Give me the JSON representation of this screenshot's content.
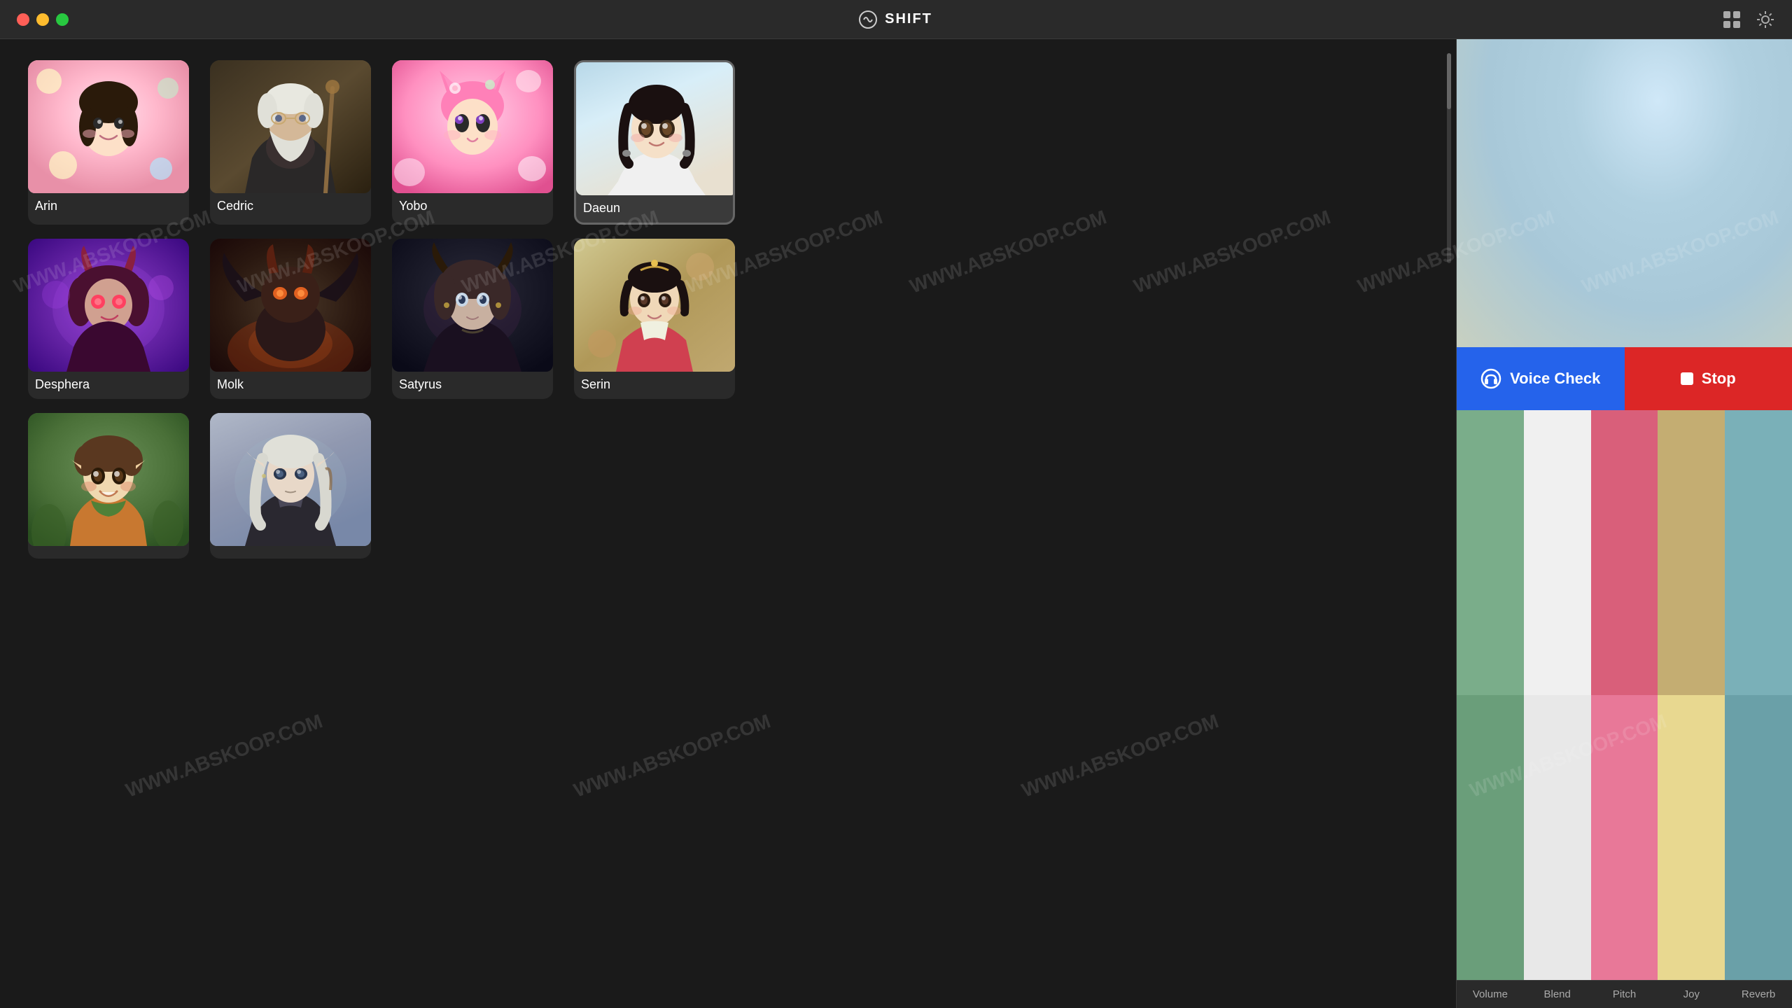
{
  "app": {
    "title": "SHIFT",
    "logo_symbol": "⟳"
  },
  "titlebar": {
    "traffic_lights": [
      "red",
      "yellow",
      "green"
    ],
    "right_icons": [
      "grid-icon",
      "settings-icon"
    ]
  },
  "characters": [
    {
      "id": "arin",
      "name": "Arin",
      "style": "arin",
      "selected": false
    },
    {
      "id": "cedric",
      "name": "Cedric",
      "style": "cedric",
      "selected": false
    },
    {
      "id": "yobo",
      "name": "Yobo",
      "style": "yobo",
      "selected": false
    },
    {
      "id": "daeun",
      "name": "Daeun",
      "style": "daeun",
      "selected": true
    },
    {
      "id": "desphera",
      "name": "Desphera",
      "style": "desphera",
      "selected": false
    },
    {
      "id": "molk",
      "name": "Molk",
      "style": "molk",
      "selected": false
    },
    {
      "id": "satyrus",
      "name": "Satyrus",
      "style": "satyrus",
      "selected": false
    },
    {
      "id": "serin",
      "name": "Serin",
      "style": "serin",
      "selected": false
    },
    {
      "id": "elf1",
      "name": "",
      "style": "elf1",
      "selected": false
    },
    {
      "id": "elf2",
      "name": "",
      "style": "elf2",
      "selected": false
    }
  ],
  "right_panel": {
    "selected_character": "Daeun",
    "voice_check_label": "Voice Check",
    "stop_label": "Stop",
    "color_swatches": [
      {
        "row": 1,
        "cells": [
          {
            "color": "#7aad8a"
          },
          {
            "color": "#f0f0f0"
          },
          {
            "color": "#d95f7a"
          },
          {
            "color": "#c4ad72"
          },
          {
            "color": "#7ab0b8"
          }
        ]
      },
      {
        "row": 2,
        "cells": [
          {
            "color": "#7aad8a"
          },
          {
            "color": "#f0f0f0"
          },
          {
            "color": "#e87898"
          },
          {
            "color": "#e8d890"
          },
          {
            "color": "#7ab0b8"
          }
        ]
      }
    ],
    "color_labels": [
      "Volume",
      "Blend",
      "Pitch",
      "Joy",
      "Reverb"
    ]
  },
  "watermark": "WWW.ABSKOOP.COM"
}
